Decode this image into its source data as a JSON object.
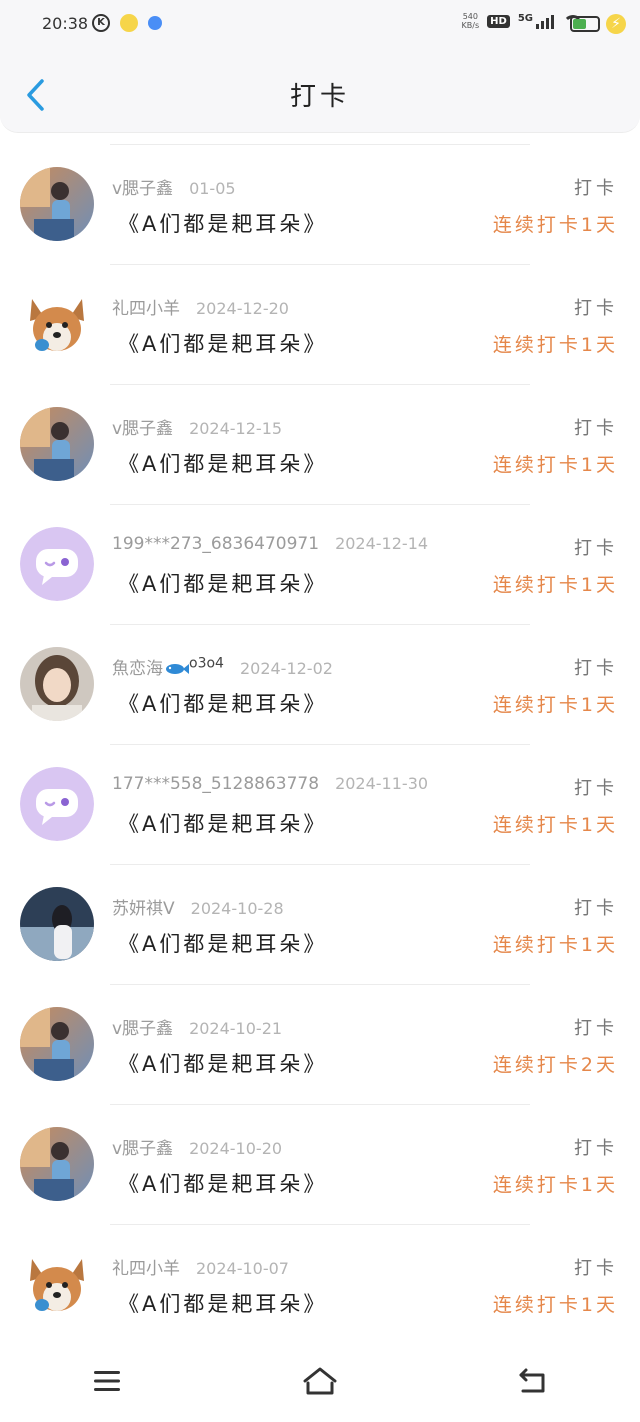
{
  "status_bar": {
    "time": "20:38",
    "net_speed_top": "540",
    "net_speed_bottom": "KB/s",
    "hd_label": "HD",
    "signal_label": "5G",
    "battery_level": 0.55,
    "battery_color": "#4caf50"
  },
  "header": {
    "title": "打卡"
  },
  "colors": {
    "accent_blue": "#2a9be0",
    "streak_orange": "#e5874a"
  },
  "items": [
    {
      "name": "v腮子鑫",
      "date": "01-05",
      "book": "《A们都是耙耳朵》",
      "action": "打卡",
      "streak": "连续打卡1天",
      "avatar": "photo-boy"
    },
    {
      "name": "礼四小羊",
      "date": "2024-12-20",
      "book": "《A们都是耙耳朵》",
      "action": "打卡",
      "streak": "连续打卡1天",
      "avatar": "dog"
    },
    {
      "name": "v腮子鑫",
      "date": "2024-12-15",
      "book": "《A们都是耙耳朵》",
      "action": "打卡",
      "streak": "连续打卡1天",
      "avatar": "photo-boy"
    },
    {
      "name": "199***273_6836470971",
      "date": "2024-12-14",
      "book": "《A们都是耙耳朵》",
      "action": "打卡",
      "streak": "连续打卡1天",
      "avatar": "chat-bubble"
    },
    {
      "name": "魚恋海",
      "name_suffix": "o3o4",
      "date": "2024-12-02",
      "book": "《A们都是耙耳朵》",
      "action": "打卡",
      "streak": "连续打卡1天",
      "avatar": "photo-portrait"
    },
    {
      "name": "177***558_5128863778",
      "date": "2024-11-30",
      "book": "《A们都是耙耳朵》",
      "action": "打卡",
      "streak": "连续打卡1天",
      "avatar": "chat-bubble"
    },
    {
      "name": "苏妍祺V",
      "date": "2024-10-28",
      "book": "《A们都是耙耳朵》",
      "action": "打卡",
      "streak": "连续打卡1天",
      "avatar": "photo-girl"
    },
    {
      "name": "v腮子鑫",
      "date": "2024-10-21",
      "book": "《A们都是耙耳朵》",
      "action": "打卡",
      "streak": "连续打卡2天",
      "avatar": "photo-boy"
    },
    {
      "name": "v腮子鑫",
      "date": "2024-10-20",
      "book": "《A们都是耙耳朵》",
      "action": "打卡",
      "streak": "连续打卡1天",
      "avatar": "photo-boy"
    },
    {
      "name": "礼四小羊",
      "date": "2024-10-07",
      "book": "《A们都是耙耳朵》",
      "action": "打卡",
      "streak": "连续打卡1天",
      "avatar": "dog"
    }
  ],
  "nav_bar": {
    "items": [
      "menu-icon",
      "home-icon",
      "back-icon"
    ]
  }
}
